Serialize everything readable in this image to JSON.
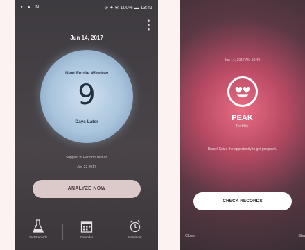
{
  "left_screen": {
    "status_left": "▪ ▲ N",
    "status_right": "⊘ ✦ ✉ 100% ▬ 13:41",
    "date": "Jun 14, 2017",
    "circle_title": "Next Fertile Window",
    "days_value": "9",
    "days_label": "Days Later",
    "suggest_line1": "Suggest to Perform Test on",
    "suggest_line2": "Jun 22 2017",
    "analyze_button": "ANALYZE NOW",
    "tabs": [
      {
        "label": "Test Records",
        "icon": "flask-icon"
      },
      {
        "label": "Calendar",
        "icon": "calendar-icon"
      },
      {
        "label": "Reminder",
        "icon": "alarm-clock-icon"
      }
    ]
  },
  "right_screen": {
    "timestamp": "Jun 14, 2017 AM 10:49",
    "emoji_icon": "heart-eyes-face-icon",
    "level": "PEAK",
    "level_sub": "Fertility",
    "message": "Brace! Seize the opportunity to get pregnant.",
    "check_button": "CHECK RECORDS",
    "close_label": "Close",
    "share_label": "Sha"
  },
  "colors": {
    "circle_blue": "#a9c4dc",
    "analyze_button_bg": "#dccaca",
    "peak_pink": "#e86c84"
  }
}
